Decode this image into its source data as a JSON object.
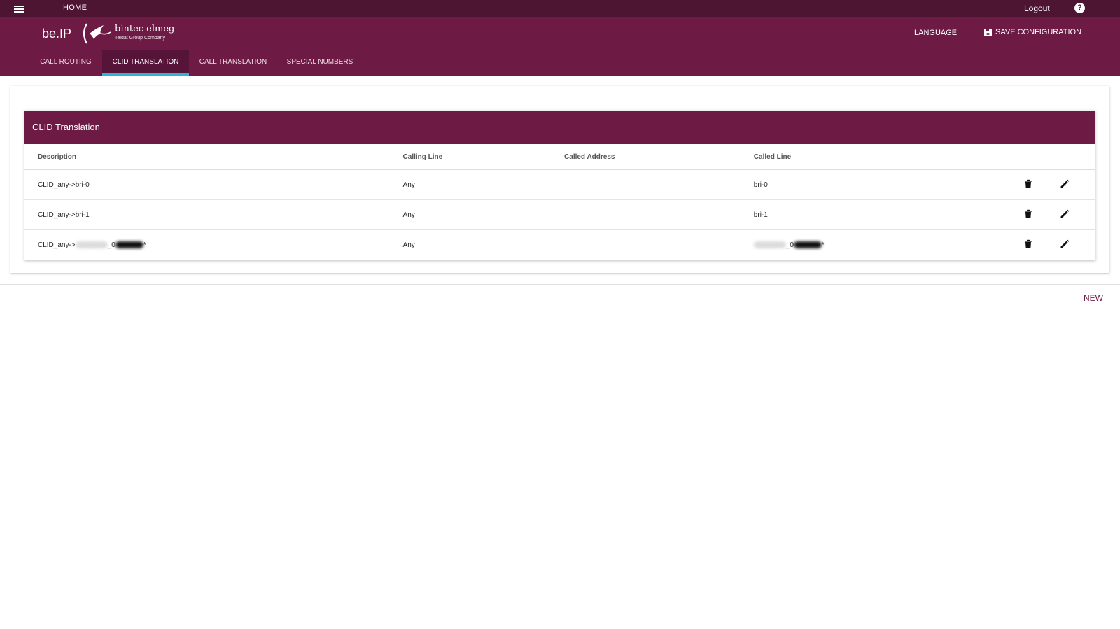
{
  "topbar": {
    "home": "HOME",
    "logout": "Logout",
    "help": "?"
  },
  "header": {
    "brand": "be.IP",
    "logo_main": "bintec elmeg",
    "logo_sub": "Teldat Group Company",
    "language": "LANGUAGE",
    "save": "SAVE CONFIGURATION"
  },
  "tabs": [
    {
      "label": "CALL ROUTING",
      "active": false
    },
    {
      "label": "CLID TRANSLATION",
      "active": true
    },
    {
      "label": "CALL TRANSLATION",
      "active": false
    },
    {
      "label": "SPECIAL NUMBERS",
      "active": false
    }
  ],
  "panel": {
    "title": "CLID Translation",
    "columns": [
      "Description",
      "Calling Line",
      "Called Address",
      "Called Line"
    ],
    "rows": [
      {
        "description": "CLID_any->bri-0",
        "calling_line": "Any",
        "called_address": "",
        "called_line": "bri-0"
      },
      {
        "description": "CLID_any->bri-1",
        "calling_line": "Any",
        "called_address": "",
        "called_line": "bri-1"
      },
      {
        "description_prefix": "CLID_any->",
        "description_mid": "_0",
        "description_suffix": "*",
        "calling_line": "Any",
        "called_address": "",
        "called_line_mid": "_0",
        "called_line_suffix": "*"
      }
    ]
  },
  "footer": {
    "new": "NEW"
  },
  "colors": {
    "topbar": "#4e1533",
    "header": "#6d1b44",
    "tab_active": "#561438",
    "tab_indicator": "#2fb4d8"
  }
}
